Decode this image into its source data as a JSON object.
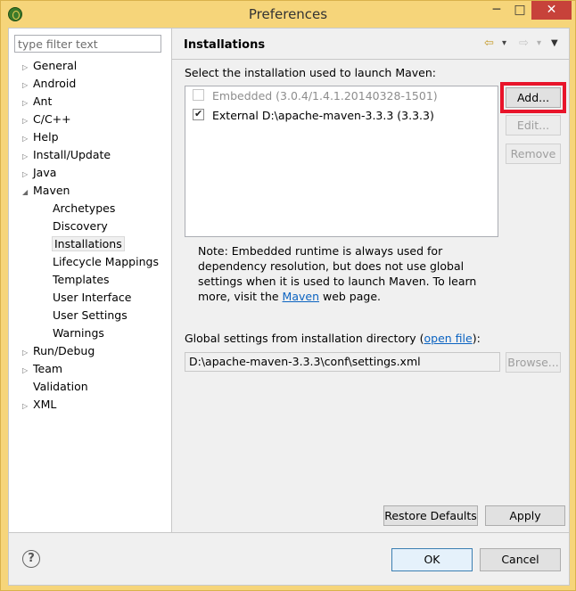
{
  "window": {
    "title": "Preferences",
    "min_glyph": "─",
    "max_glyph": "□",
    "close_glyph": "✕"
  },
  "filter": {
    "placeholder": "type filter text"
  },
  "tree": [
    {
      "label": "General",
      "expander": "▷"
    },
    {
      "label": "Android",
      "expander": "▷"
    },
    {
      "label": "Ant",
      "expander": "▷"
    },
    {
      "label": "C/C++",
      "expander": "▷"
    },
    {
      "label": "Help",
      "expander": "▷"
    },
    {
      "label": "Install/Update",
      "expander": "▷"
    },
    {
      "label": "Java",
      "expander": "▷"
    },
    {
      "label": "Maven",
      "expander": "◢"
    },
    {
      "label": "Archetypes"
    },
    {
      "label": "Discovery"
    },
    {
      "label": "Installations",
      "selected": true
    },
    {
      "label": "Lifecycle Mappings"
    },
    {
      "label": "Templates"
    },
    {
      "label": "User Interface"
    },
    {
      "label": "User Settings"
    },
    {
      "label": "Warnings"
    },
    {
      "label": "Run/Debug",
      "expander": "▷"
    },
    {
      "label": "Team",
      "expander": "▷"
    },
    {
      "label": "Validation"
    },
    {
      "label": "XML",
      "expander": "▷"
    }
  ],
  "page": {
    "title": "Installations",
    "nav": {
      "back": "⇦",
      "forward": "⇨",
      "dropdown": "▾",
      "menu": "▼"
    },
    "select_label": "Select the installation used to launch Maven:",
    "installations": [
      {
        "label": "Embedded (3.0.4/1.4.1.20140328-1501)",
        "checked": false,
        "enabled": false
      },
      {
        "label": "External D:\\apache-maven-3.3.3 (3.3.3)",
        "checked": true,
        "enabled": true
      }
    ],
    "buttons": {
      "add": "Add...",
      "edit": "Edit...",
      "remove": "Remove",
      "browse": "Browse..."
    },
    "note": {
      "text": "Note: Embedded runtime is always used for dependency resolution, but does not use global settings when it is used to launch Maven. To learn more, visit the ",
      "link": "Maven",
      "tail": " web page."
    },
    "global_label_prefix": "Global settings from installation directory (",
    "global_link": "open file",
    "global_label_suffix": "):",
    "settings_path": "D:\\apache-maven-3.3.3\\conf\\settings.xml",
    "restore_defaults": "Restore Defaults",
    "apply": "Apply"
  },
  "footer": {
    "help": "?",
    "ok": "OK",
    "cancel": "Cancel"
  },
  "colors": {
    "titlebar": "#f6d57a",
    "close": "#c7423a",
    "highlight": "#e8142a",
    "link": "#0b63c1"
  }
}
